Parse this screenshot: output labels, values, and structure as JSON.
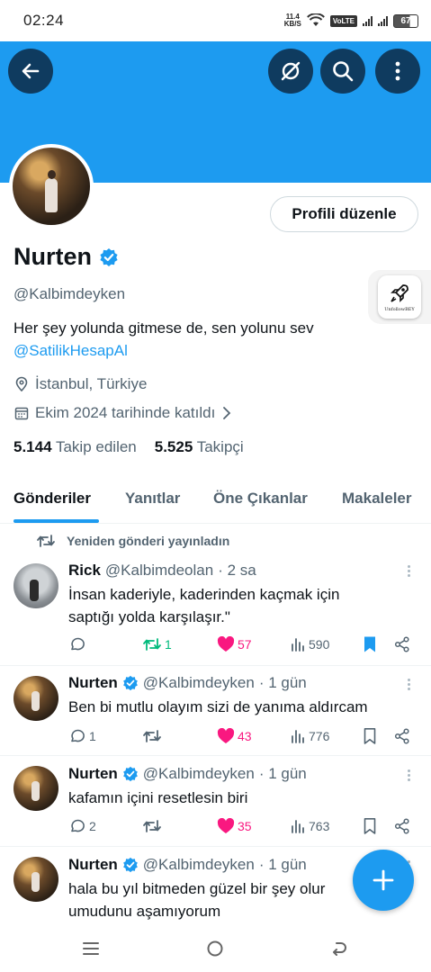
{
  "status_bar": {
    "time": "02:24",
    "net_speed_value": "11.4",
    "net_speed_unit": "KB/S",
    "volte": "VoLTE",
    "battery": "67"
  },
  "profile": {
    "name": "Nurten",
    "handle": "@Kalbimdeyken",
    "bio": "Her şey yolunda gitmese de, sen yolunu sev",
    "bio_mention": "@SatilikHesapAl",
    "location": "İstanbul, Türkiye",
    "joined": "Ekim 2024 tarihinde katıldı",
    "following_count": "5.144",
    "following_label": "Takip edilen",
    "followers_count": "5.525",
    "followers_label": "Takipçi",
    "edit_button": "Profili düzenle",
    "widget_label": "UnfollowBEY"
  },
  "tabs": [
    {
      "label": "Gönderiler",
      "active": true
    },
    {
      "label": "Yanıtlar",
      "active": false
    },
    {
      "label": "Öne Çıkanlar",
      "active": false
    },
    {
      "label": "Makaleler",
      "active": false
    }
  ],
  "repost_note": "Yeniden gönderi yayınladın",
  "posts": [
    {
      "name": "Rick",
      "verified": false,
      "handle": "@Kalbimdeolan",
      "time": "· 2 sa",
      "text": "İnsan kaderiyle, kaderinden kaçmak için saptığı yolda karşılaşır.\"",
      "replies": "",
      "reposts": "1",
      "likes": "57",
      "views": "590",
      "bookmarked": true
    },
    {
      "name": "Nurten",
      "verified": true,
      "handle": "@Kalbimdeyken",
      "time": "· 1 gün",
      "text": "Ben bi mutlu olayım sizi de yanıma aldırcam",
      "replies": "1",
      "reposts": "",
      "likes": "43",
      "views": "776",
      "bookmarked": false
    },
    {
      "name": "Nurten",
      "verified": true,
      "handle": "@Kalbimdeyken",
      "time": "· 1 gün",
      "text": "kafamın içini resetlesin biri",
      "replies": "2",
      "reposts": "",
      "likes": "35",
      "views": "763",
      "bookmarked": false
    },
    {
      "name": "Nurten",
      "verified": true,
      "handle": "@Kalbimdeyken",
      "time": "· 1 gün",
      "text": "hala bu yıl bitmeden güzel bir şey olur umudunu aşamıyorum"
    }
  ],
  "colors": {
    "brand": "#1d9bf0",
    "banner_button": "#0f3b5f",
    "like": "#f91880",
    "repost_active": "#00ba7c",
    "muted_text": "#536471"
  },
  "icons": [
    "back-arrow-icon",
    "grok-icon",
    "search-icon",
    "more-vertical-icon",
    "verified-badge-icon",
    "location-pin-icon",
    "calendar-icon",
    "chevron-right-icon",
    "repost-icon",
    "reply-icon",
    "like-icon",
    "views-icon",
    "bookmark-icon",
    "share-icon",
    "plus-icon",
    "rocket-icon",
    "menu-icon",
    "home-circle-icon",
    "back-nav-icon"
  ]
}
